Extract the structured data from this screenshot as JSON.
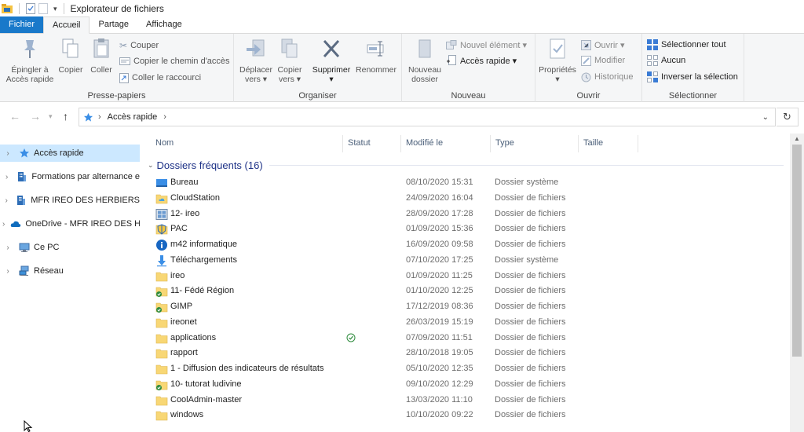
{
  "window": {
    "title": "Explorateur de fichiers"
  },
  "tabs": [
    {
      "label": "Fichier"
    },
    {
      "label": "Accueil"
    },
    {
      "label": "Partage"
    },
    {
      "label": "Affichage"
    }
  ],
  "ribbon": {
    "pressepapiers": {
      "label": "Presse-papiers",
      "epingler": "Épingler à\nAccès rapide",
      "copier": "Copier",
      "coller": "Coller",
      "couper": "Couper",
      "copier_chemin": "Copier le chemin d'accès",
      "coller_raccourci": "Coller le raccourci"
    },
    "organiser": {
      "label": "Organiser",
      "deplacer": "Déplacer\nvers ▾",
      "copier_vers": "Copier\nvers ▾",
      "supprimer": "Supprimer\n▾",
      "renommer": "Renommer"
    },
    "nouveau": {
      "label": "Nouveau",
      "nouveau_dossier": "Nouveau\ndossier",
      "nouvel_element": "Nouvel élément ▾",
      "acces_rapide": "Accès rapide ▾"
    },
    "ouvrir": {
      "label": "Ouvrir",
      "proprietes": "Propriétés\n▾",
      "ouvrir": "Ouvrir ▾",
      "modifier": "Modifier",
      "historique": "Historique"
    },
    "selectionner": {
      "label": "Sélectionner",
      "tout": "Sélectionner tout",
      "aucun": "Aucun",
      "inverser": "Inverser la sélection"
    }
  },
  "address": {
    "path": "Accès rapide",
    "sep": "›"
  },
  "nav": {
    "items": [
      {
        "label": "Accès rapide",
        "icon": "star-icon"
      },
      {
        "label": "Formations par alternance e",
        "icon": "building-icon"
      },
      {
        "label": "MFR IREO DES HERBIERS",
        "icon": "building-icon"
      },
      {
        "label": "OneDrive - MFR IREO DES H",
        "icon": "cloud-icon"
      },
      {
        "label": "Ce PC",
        "icon": "pc-icon"
      },
      {
        "label": "Réseau",
        "icon": "network-icon"
      }
    ]
  },
  "list": {
    "columns": {
      "name": "Nom",
      "status": "Statut",
      "modified": "Modifié le",
      "type": "Type",
      "size": "Taille"
    },
    "group": "Dossiers fréquents (16)",
    "rows": [
      {
        "name": "Bureau",
        "date": "08/10/2020 15:31",
        "type": "Dossier système",
        "icon": "desktop-icon",
        "status": ""
      },
      {
        "name": "CloudStation",
        "date": "24/09/2020 16:04",
        "type": "Dossier de fichiers",
        "icon": "cloudstation-folder-icon",
        "status": ""
      },
      {
        "name": "12- ireo",
        "date": "28/09/2020 17:28",
        "type": "Dossier de fichiers",
        "icon": "network-folder-icon",
        "status": ""
      },
      {
        "name": "PAC",
        "date": "01/09/2020 15:36",
        "type": "Dossier de fichiers",
        "icon": "shield-folder-icon",
        "status": ""
      },
      {
        "name": "m42 informatique",
        "date": "16/09/2020 09:58",
        "type": "Dossier de fichiers",
        "icon": "info-icon",
        "status": ""
      },
      {
        "name": "Téléchargements",
        "date": "07/10/2020 17:25",
        "type": "Dossier système",
        "icon": "download-icon",
        "status": ""
      },
      {
        "name": "ireo",
        "date": "01/09/2020 11:25",
        "type": "Dossier de fichiers",
        "icon": "folder-icon",
        "status": ""
      },
      {
        "name": "11- Fédé Région",
        "date": "01/10/2020 12:25",
        "type": "Dossier de fichiers",
        "icon": "synced-folder-icon",
        "status": ""
      },
      {
        "name": "GIMP",
        "date": "17/12/2019 08:36",
        "type": "Dossier de fichiers",
        "icon": "synced-folder-icon",
        "status": ""
      },
      {
        "name": "ireonet",
        "date": "26/03/2019 15:19",
        "type": "Dossier de fichiers",
        "icon": "folder-icon",
        "status": ""
      },
      {
        "name": "applications",
        "date": "07/09/2020 11:51",
        "type": "Dossier de fichiers",
        "icon": "folder-icon",
        "status": "synced"
      },
      {
        "name": "rapport",
        "date": "28/10/2018 19:05",
        "type": "Dossier de fichiers",
        "icon": "folder-icon",
        "status": ""
      },
      {
        "name": "1 - Diffusion des indicateurs de résultats",
        "date": "05/10/2020 12:35",
        "type": "Dossier de fichiers",
        "icon": "folder-icon",
        "status": ""
      },
      {
        "name": "10- tutorat ludivine",
        "date": "09/10/2020 12:29",
        "type": "Dossier de fichiers",
        "icon": "synced-folder-icon",
        "status": ""
      },
      {
        "name": "CoolAdmin-master",
        "date": "13/03/2020 11:10",
        "type": "Dossier de fichiers",
        "icon": "folder-icon",
        "status": ""
      },
      {
        "name": "windows",
        "date": "10/10/2020 09:22",
        "type": "Dossier de fichiers",
        "icon": "folder-icon",
        "status": ""
      }
    ]
  },
  "colors": {
    "accent": "#1979ca",
    "selection": "#cce8ff",
    "group_header": "#1e3287",
    "folder": "#f8d775",
    "synced": "#2e8b3d"
  }
}
